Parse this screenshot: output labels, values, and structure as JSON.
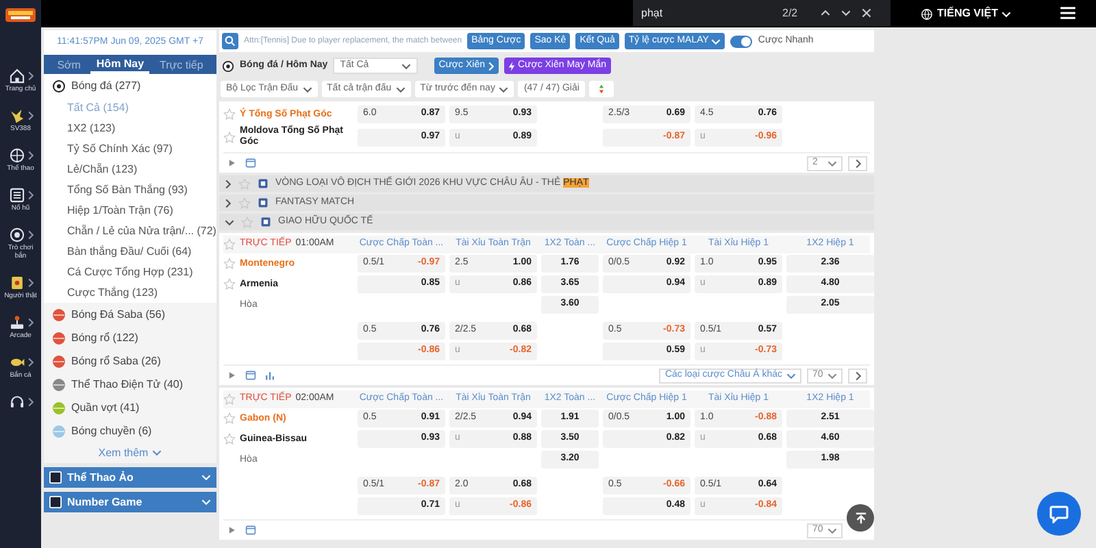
{
  "find_bar": {
    "query": "phạt",
    "count": "2/2"
  },
  "language": "TIẾNG VIỆT",
  "rail": [
    {
      "kind": "home",
      "label": "Trang chủ"
    },
    {
      "kind": "bird",
      "label": "SV388"
    },
    {
      "kind": "ball",
      "label": "Thể thao"
    },
    {
      "kind": "slot",
      "label": "Nổ hũ"
    },
    {
      "kind": "target",
      "label": "Trò chơi bắn"
    },
    {
      "kind": "cards",
      "label": "Người thật"
    },
    {
      "kind": "arcade",
      "label": "Arcade"
    },
    {
      "kind": "fish",
      "label": "Bắn cá"
    },
    {
      "kind": "support"
    }
  ],
  "sidebar": {
    "clock": "11:41:57PM Jun 09, 2025 GMT +7",
    "tabs": [
      {
        "label": "Sớm",
        "selected": false
      },
      {
        "label": "Hôm Nay",
        "selected": true
      },
      {
        "label": "Trực tiếp",
        "selected": false
      }
    ],
    "sports": [
      {
        "kind": "soccer",
        "label": "Bóng đá",
        "count": "(277)",
        "children": [
          {
            "label": "Tất Cả",
            "count": "(154)",
            "selected": true
          },
          {
            "label": "1X2",
            "count": "(123)",
            "selected": false
          },
          {
            "label": "Tỷ Số Chính Xác",
            "count": "(97)",
            "selected": false
          },
          {
            "label": "Lẻ/Chẵn",
            "count": "(123)",
            "selected": false
          },
          {
            "label": "Tổng Số Bàn Thắng",
            "count": "(93)",
            "selected": false
          },
          {
            "label": "Hiệp 1/Toàn Trận",
            "count": "(76)",
            "selected": false
          },
          {
            "label": "Chẵn / Lẻ của Nửa trận/...",
            "count": "(72)",
            "selected": false
          },
          {
            "label": "Bàn thắng Đầu/ Cuối",
            "count": "(64)",
            "selected": false
          },
          {
            "label": "Cá Cược Tổng Hợp",
            "count": "(231)",
            "selected": false
          },
          {
            "label": "Cược Thắng",
            "count": "(123)",
            "selected": false
          }
        ]
      },
      {
        "kind": "basketball",
        "label": "Bóng Đá Saba",
        "count": "(56)"
      },
      {
        "kind": "basketball",
        "label": "Bóng rổ",
        "count": "(122)"
      },
      {
        "kind": "basketball",
        "label": "Bóng rổ Saba",
        "count": "(26)"
      },
      {
        "kind": "esports",
        "label": "Thể Thao Điện Tử",
        "count": "(40)"
      },
      {
        "kind": "tennis",
        "label": "Quần vợt",
        "count": "(41)"
      },
      {
        "kind": "volleyball",
        "label": "Bóng chuyền",
        "count": "(6)"
      }
    ],
    "more": "Xem thêm",
    "sections": [
      "Thể Thao Ảo",
      "Number Game"
    ]
  },
  "toolbar": {
    "notice": "Attn:[Tennis] Due to player replacement, the match between",
    "buttons": [
      "Bảng Cược",
      "Sao Kê",
      "Kết Quả"
    ],
    "odds_type": "Tỷ lệ cược MALAY",
    "quick_bet": {
      "label": "Cược Nhanh",
      "on": true
    }
  },
  "breadcrumb": "Bóng đá / Hôm Nay",
  "market_select": "Tất Cả",
  "parlay": "Cược Xiên",
  "lucky_parlay": "Cược Xiên May Mắn",
  "filters": [
    {
      "kind": "dropdown",
      "label": "Bộ Lọc Trận Đấu"
    },
    {
      "kind": "dropdown",
      "label": "Tất cả trận đấu"
    },
    {
      "kind": "dropdown",
      "label": "Từ trước đến nay"
    },
    {
      "kind": "count",
      "label": "(47 / 47) Giải"
    }
  ],
  "blocks": [
    {
      "kind": "match",
      "rows": [
        {
          "kind": "home",
          "team": "Ý Tổng Số Phạt Góc",
          "cells": [
            {
              "line": "6.0",
              "odds": "0.87"
            },
            {
              "line": "9.5",
              "odds": "0.93"
            },
            null,
            {
              "line": "2.5/3",
              "odds": "0.69"
            },
            {
              "line": "4.5",
              "odds": "0.76"
            },
            null
          ]
        },
        {
          "kind": "away",
          "team": "Moldova Tổng Số Phạt Góc",
          "cells": [
            {
              "odds": "0.97"
            },
            {
              "line": "u",
              "odds": "0.89"
            },
            null,
            {
              "odds": "-0.87"
            },
            {
              "line": "u",
              "odds": "-0.96"
            },
            null
          ]
        }
      ],
      "footer": {
        "chart": false,
        "page_size": "2",
        "next_button": true
      }
    },
    {
      "kind": "league",
      "name": "VÒNG LOẠI VÔ ĐỊCH THẾ GIỚI 2026 KHU VỰC CHÂU ÂU - THẺ ",
      "highlight": "PHẠT",
      "expanded": false
    },
    {
      "kind": "league",
      "name": "FANTASY MATCH",
      "expanded": false
    },
    {
      "kind": "league",
      "name": "GIAO HỮU QUỐC TẾ",
      "expanded": true
    },
    {
      "kind": "match",
      "status": "TRỰC TIẾP",
      "time": "01:00AM",
      "columns": [
        "Cược Chấp Toàn ...",
        "Tài Xỉu Toàn Trận",
        "1X2 Toàn ...",
        "Cược Chấp Hiệp 1",
        "Tài Xỉu Hiệp 1",
        "1X2 Hiệp 1"
      ],
      "rows": [
        {
          "kind": "home",
          "team": "Montenegro",
          "cells": [
            {
              "line": "0.5/1",
              "odds": "-0.97"
            },
            {
              "line": "2.5",
              "odds": "1.00"
            },
            {
              "odds": "1.76"
            },
            {
              "line": "0/0.5",
              "odds": "0.92"
            },
            {
              "line": "1.0",
              "odds": "0.95"
            },
            {
              "odds": "2.36"
            }
          ]
        },
        {
          "kind": "away",
          "team": "Armenia",
          "cells": [
            {
              "odds": "0.85"
            },
            {
              "line": "u",
              "odds": "0.86"
            },
            {
              "odds": "3.65"
            },
            {
              "odds": "0.94"
            },
            {
              "line": "u",
              "odds": "0.89"
            },
            {
              "odds": "4.80"
            }
          ]
        },
        {
          "kind": "draw",
          "team": "Hòa",
          "cells": [
            null,
            null,
            {
              "odds": "3.60"
            },
            null,
            null,
            {
              "odds": "2.05"
            }
          ]
        },
        {
          "kind": "extra",
          "cells": [
            {
              "line": "0.5",
              "odds": "0.76"
            },
            {
              "line": "2/2.5",
              "odds": "0.68"
            },
            null,
            {
              "line": "0.5",
              "odds": "-0.73"
            },
            {
              "line": "0.5/1",
              "odds": "0.57"
            },
            null
          ]
        },
        {
          "kind": "extra",
          "cells": [
            {
              "odds": "-0.86"
            },
            {
              "line": "u",
              "odds": "-0.82"
            },
            null,
            {
              "odds": "0.59"
            },
            {
              "line": "u",
              "odds": "-0.73"
            },
            null
          ]
        }
      ],
      "footer": {
        "chart": true,
        "market_select": "Các loại cược Châu Á khác",
        "page_size": "70",
        "next_button": true
      }
    },
    {
      "kind": "match",
      "status": "TRỰC TIẾP",
      "time": "02:00AM",
      "columns": [
        "Cược Chấp Toàn ...",
        "Tài Xỉu Toàn Trận",
        "1X2 Toàn ...",
        "Cược Chấp Hiệp 1",
        "Tài Xỉu Hiệp 1",
        "1X2 Hiệp 1"
      ],
      "rows": [
        {
          "kind": "home",
          "team": "Gabon (N)",
          "cells": [
            {
              "line": "0.5",
              "odds": "0.91"
            },
            {
              "line": "2/2.5",
              "odds": "0.94"
            },
            {
              "odds": "1.91"
            },
            {
              "line": "0/0.5",
              "odds": "1.00"
            },
            {
              "line": "1.0",
              "odds": "-0.88"
            },
            {
              "odds": "2.51"
            }
          ]
        },
        {
          "kind": "away",
          "team": "Guinea-Bissau",
          "cells": [
            {
              "odds": "0.93"
            },
            {
              "line": "u",
              "odds": "0.88"
            },
            {
              "odds": "3.50"
            },
            {
              "odds": "0.82"
            },
            {
              "line": "u",
              "odds": "0.68"
            },
            {
              "odds": "4.60"
            }
          ]
        },
        {
          "kind": "draw",
          "team": "Hòa",
          "cells": [
            null,
            null,
            {
              "odds": "3.20"
            },
            null,
            null,
            {
              "odds": "1.98"
            }
          ]
        },
        {
          "kind": "extra",
          "cells": [
            {
              "line": "0.5/1",
              "odds": "-0.87"
            },
            {
              "line": "2.0",
              "odds": "0.68"
            },
            null,
            {
              "line": "0.5",
              "odds": "-0.66"
            },
            {
              "line": "0.5/1",
              "odds": "0.64"
            },
            null
          ]
        },
        {
          "kind": "extra",
          "cells": [
            {
              "odds": "0.71"
            },
            {
              "line": "u",
              "odds": "-0.86"
            },
            null,
            {
              "odds": "0.48"
            },
            {
              "line": "u",
              "odds": "-0.84"
            },
            null
          ]
        }
      ],
      "footer": {
        "chart": false,
        "page_size": "70",
        "next_button": false
      }
    }
  ]
}
